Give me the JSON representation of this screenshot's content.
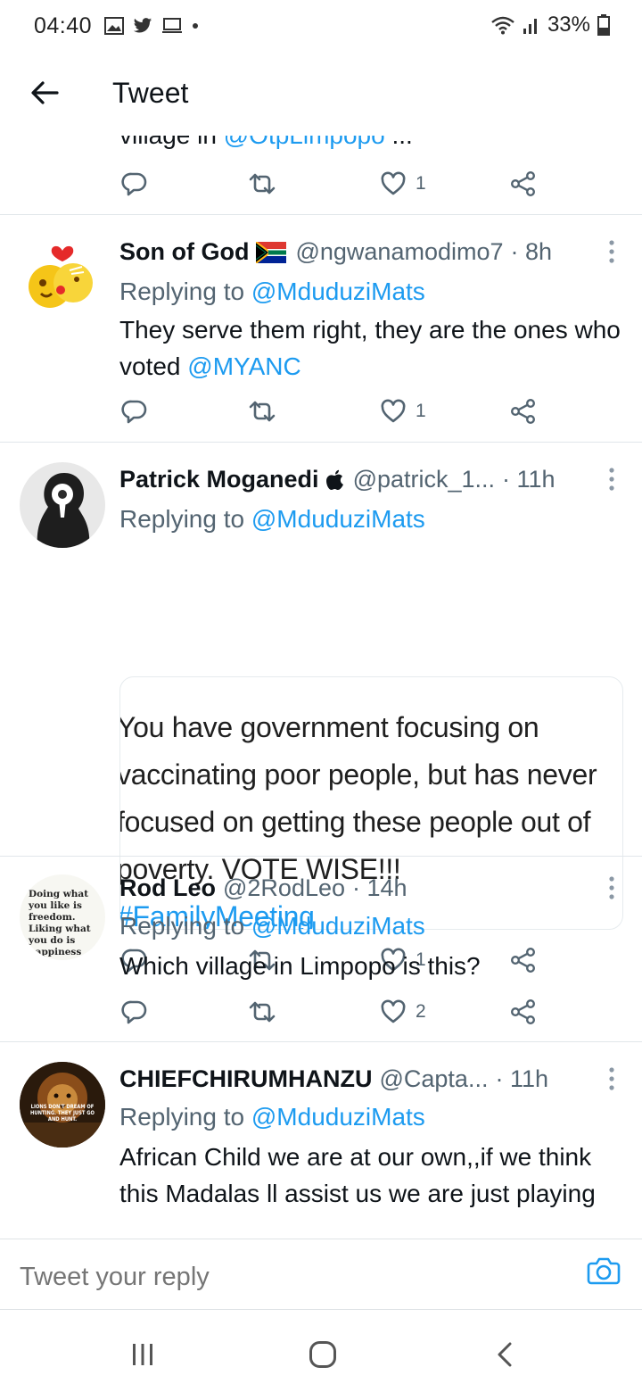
{
  "status_bar": {
    "time": "04:40",
    "battery": "33%"
  },
  "header": {
    "title": "Tweet"
  },
  "cut_tweet": {
    "text_prefix": "village in ",
    "mention": "@OtpLimpopo",
    "suffix": " ...",
    "likes": "1"
  },
  "tweets": [
    {
      "name": "Son of God",
      "handle": "@ngwanamodimo7",
      "time": "· 8h",
      "replying_prefix": "Replying to ",
      "replying_to": "@MduduziMats",
      "body_text": "They serve them right, they are the ones who voted ",
      "body_mention": "@MYANC",
      "likes": "1"
    },
    {
      "name": "Patrick Moganedi",
      "handle": "@patrick_1...",
      "time": "· 11h",
      "replying_prefix": "Replying to ",
      "replying_to": "@MduduziMats",
      "image_text": "You have government focusing on vaccinating poor people, but has never focused on getting these people out of poverty. VOTE WISE!!!",
      "image_hashtag": "#FamilyMeeting",
      "likes": "1"
    },
    {
      "name": "Rod Leo",
      "handle": "@2RodLeo",
      "time": "· 14h",
      "replying_prefix": "Replying to ",
      "replying_to": "@MduduziMats",
      "body_text": "Which village in Limpopo is this?",
      "avatar_text": "Doing what you like is freedom. Liking what you do is happiness",
      "likes": "2"
    },
    {
      "name": "CHIEFCHIRUMHANZU",
      "handle": "@Capta...",
      "time": "· 11h",
      "replying_prefix": "Replying to ",
      "replying_to": "@MduduziMats",
      "body_text": "African Child we are at our own,,if we think this Madalas ll assist us we are just playing",
      "avatar_text": "LIONS DON'T DREAM OF HUNTING. THEY JUST GO AND HUNT."
    }
  ],
  "reply_bar": {
    "placeholder": "Tweet your reply"
  },
  "colors": {
    "accent": "#1d9bf0",
    "secondary_text": "#536471",
    "divider": "#e1e6ea"
  },
  "icons": [
    "back-arrow-icon",
    "reply-icon",
    "retweet-icon",
    "like-icon",
    "share-icon",
    "more-icon",
    "camera-icon",
    "recents-icon",
    "home-icon",
    "nav-back-icon"
  ]
}
